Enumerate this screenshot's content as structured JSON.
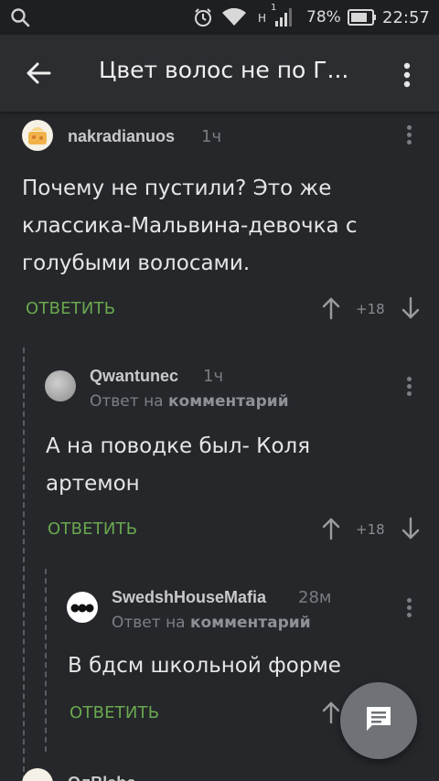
{
  "status_bar": {
    "network_label": "H",
    "sim_number": "1",
    "battery_percent": "78%",
    "time": "22:57"
  },
  "app_bar": {
    "title": "Цвет волос не по Г...",
    "back_icon": "arrow-left-icon",
    "menu_icon": "more-vert-icon"
  },
  "reply_to_prefix": "Ответ на",
  "reply_to_target": "комментарий",
  "reply_label": "ОТВЕТИТЬ",
  "comments": [
    {
      "author": "nakradianuos",
      "time": "1ч",
      "text_lines": [
        "Почему не пустили? Это же",
        "классика-Мальвина-девочка с",
        "голубыми волосами."
      ],
      "rating": "+18"
    },
    {
      "author": "Qwantunec",
      "time": "1ч",
      "text_lines": [
        "А на поводке был- Коля",
        "артемон"
      ],
      "rating": "+18"
    },
    {
      "author": "SwedshHouseMafia",
      "time": "28м",
      "text_lines": [
        "В бдсм школьной форме"
      ]
    },
    {
      "author": "ОлBlabc"
    }
  ],
  "colors": {
    "accent_green": "#6aa84f",
    "background": "#25272b",
    "app_bar": "#2b2d31"
  },
  "fab_icon": "comment-icon"
}
